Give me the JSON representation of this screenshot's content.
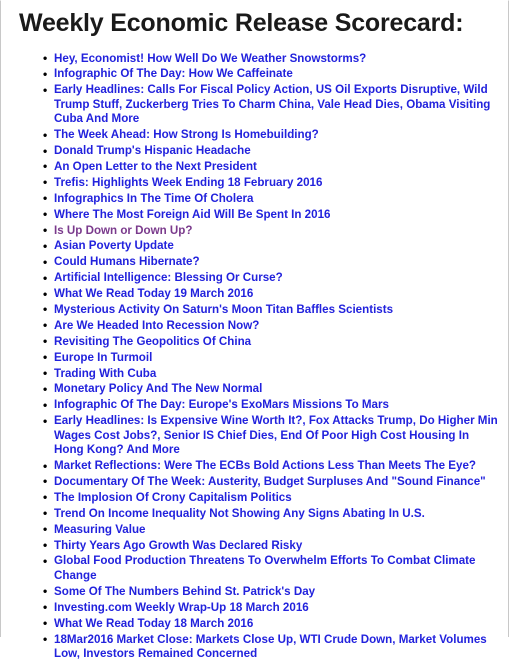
{
  "page": {
    "title": "Weekly Economic Release Scorecard:",
    "link_color": "#2222dd",
    "visited_link_color": "#7a3a8c",
    "bullet_color": "#000000",
    "background_color": "#ffffff",
    "title_color": "#1a1a1a"
  },
  "list": {
    "bullet_glyph": "•",
    "items": [
      {
        "label": "Hey, Economist! How Well Do We Weather Snowstorms?",
        "visited": false
      },
      {
        "label": "Infographic Of The Day: How We Caffeinate",
        "visited": false
      },
      {
        "label": "Early Headlines: Calls For Fiscal Policy Action, US Oil Exports Disruptive, Wild Trump Stuff, Zuckerberg Tries To Charm China, Vale Head Dies, Obama Visiting Cuba And More",
        "visited": false
      },
      {
        "label": "The Week Ahead: How Strong Is Homebuilding?",
        "visited": false
      },
      {
        "label": "Donald Trump's Hispanic Headache",
        "visited": false
      },
      {
        "label": "An Open Letter to the Next President",
        "visited": false
      },
      {
        "label": "Trefis: Highlights Week Ending 18 February 2016",
        "visited": false
      },
      {
        "label": "Infographics In The Time Of Cholera",
        "visited": false
      },
      {
        "label": "Where The Most Foreign Aid Will Be Spent In 2016",
        "visited": false
      },
      {
        "label": "Is Up Down or Down Up?",
        "visited": true
      },
      {
        "label": "Asian Poverty Update",
        "visited": false
      },
      {
        "label": "Could Humans Hibernate?",
        "visited": false
      },
      {
        "label": "Artificial Intelligence: Blessing Or Curse?",
        "visited": false
      },
      {
        "label": "What We Read Today 19 March 2016",
        "visited": false
      },
      {
        "label": "Mysterious Activity On Saturn's Moon Titan Baffles Scientists",
        "visited": false
      },
      {
        "label": "Are We Headed Into Recession Now?",
        "visited": false
      },
      {
        "label": "Revisiting The Geopolitics Of China",
        "visited": false
      },
      {
        "label": "Europe In Turmoil",
        "visited": false
      },
      {
        "label": "Trading With Cuba",
        "visited": false
      },
      {
        "label": "Monetary Policy And The New Normal",
        "visited": false
      },
      {
        "label": "Infographic Of The Day: Europe's ExoMars Missions To Mars",
        "visited": false
      },
      {
        "label": "Early Headlines: Is Expensive Wine Worth It?, Fox Attacks Trump, Do Higher Min Wages Cost Jobs?, Senior IS Chief Dies, End Of Poor High Cost Housing In Hong Kong? And More",
        "visited": false
      },
      {
        "label": "Market Reflections: Were The ECBs Bold Actions Less Than Meets The Eye?",
        "visited": false
      },
      {
        "label": "Documentary Of The Week: Austerity, Budget Surpluses And \"Sound Finance\"",
        "visited": false
      },
      {
        "label": "The Implosion Of Crony Capitalism Politics",
        "visited": false
      },
      {
        "label": "Trend On Income Inequality Not Showing Any Signs Abating In U.S.",
        "visited": false
      },
      {
        "label": "Measuring Value",
        "visited": false
      },
      {
        "label": "Thirty Years Ago Growth Was Declared Risky",
        "visited": false
      },
      {
        "label": "Global Food Production Threatens To Overwhelm Efforts To Combat Climate Change",
        "visited": false
      },
      {
        "label": "Some Of The Numbers Behind St. Patrick's Day",
        "visited": false
      },
      {
        "label": "Investing.com Weekly Wrap-Up 18 March 2016",
        "visited": false
      },
      {
        "label": "What We Read Today 18 March 2016",
        "visited": false
      },
      {
        "label": "18Mar2016 Market Close: Markets Close Up, WTI Crude Down, Market Volumes Low, Investors Remained Concerned",
        "visited": false
      }
    ]
  }
}
